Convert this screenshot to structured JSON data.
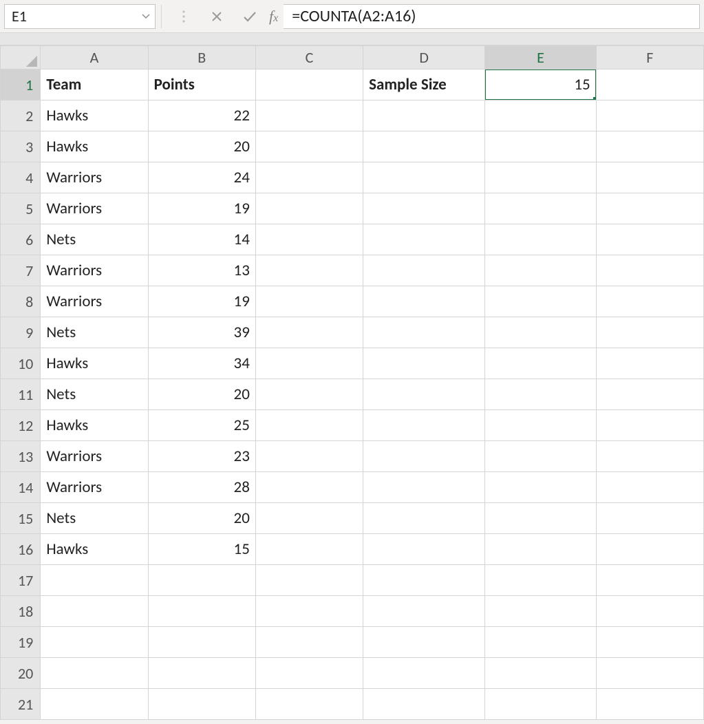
{
  "name_box": "E1",
  "formula": "=COUNTA(A2:A16)",
  "columns": [
    "A",
    "B",
    "C",
    "D",
    "E",
    "F"
  ],
  "active_col": "E",
  "active_row": 1,
  "row_count": 21,
  "headers": {
    "A": "Team",
    "B": "Points",
    "D": "Sample Size"
  },
  "active_cell_value": "15",
  "data": [
    {
      "team": "Hawks",
      "points": 22
    },
    {
      "team": "Hawks",
      "points": 20
    },
    {
      "team": "Warriors",
      "points": 24
    },
    {
      "team": "Warriors",
      "points": 19
    },
    {
      "team": "Nets",
      "points": 14
    },
    {
      "team": "Warriors",
      "points": 13
    },
    {
      "team": "Warriors",
      "points": 19
    },
    {
      "team": "Nets",
      "points": 39
    },
    {
      "team": "Hawks",
      "points": 34
    },
    {
      "team": "Nets",
      "points": 20
    },
    {
      "team": "Hawks",
      "points": 25
    },
    {
      "team": "Warriors",
      "points": 23
    },
    {
      "team": "Warriors",
      "points": 28
    },
    {
      "team": "Nets",
      "points": 20
    },
    {
      "team": "Hawks",
      "points": 15
    }
  ]
}
